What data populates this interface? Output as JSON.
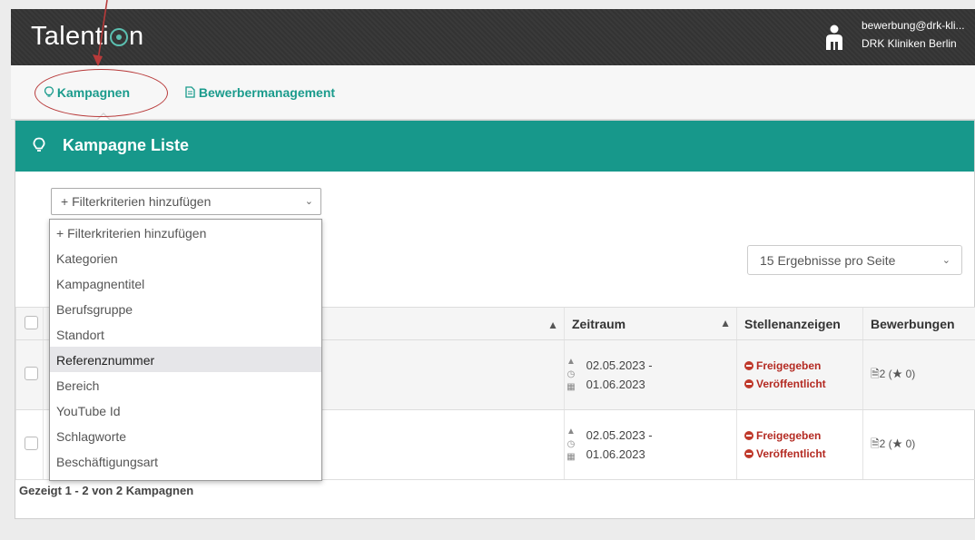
{
  "app": {
    "logo": "Talention"
  },
  "user": {
    "email": "bewerbung@drk-kli...",
    "org": "DRK Kliniken Berlin"
  },
  "nav": {
    "campaigns": "Kampagnen",
    "applicants": "Bewerbermanagement"
  },
  "panel": {
    "title": "Kampagne Liste"
  },
  "filter": {
    "placeholder": "+ Filterkriterien hinzufügen",
    "options": [
      "+ Filterkriterien hinzufügen",
      "Kategorien",
      "Kampagnentitel",
      "Berufsgruppe",
      "Standort",
      "Referenznummer",
      "Bereich",
      "YouTube Id",
      "Schlagworte",
      "Beschäftigungsart"
    ],
    "highlighted": "Referenznummer"
  },
  "perpage": {
    "value": "15 Ergebnisse pro Seite"
  },
  "table": {
    "headers": {
      "period": "Zeitraum",
      "ads": "Stellenanzeigen",
      "applications": "Bewerbungen"
    },
    "rows": [
      {
        "date_from": "02.05.2023 -",
        "date_to": "01.06.2023",
        "status1": "Freigegeben",
        "status2": "Veröffentlicht",
        "applications": "2",
        "stars": "0"
      },
      {
        "date_from": "02.05.2023 -",
        "date_to": "01.06.2023",
        "status1": "Freigegeben",
        "status2": "Veröffentlicht",
        "applications": "2",
        "stars": "0"
      }
    ]
  },
  "footer": {
    "summary": "Gezeigt 1 - 2 von 2 Kampagnen"
  },
  "colors": {
    "accent": "#17988b",
    "status_red": "#b42a22",
    "annotation": "#b83a3a"
  }
}
